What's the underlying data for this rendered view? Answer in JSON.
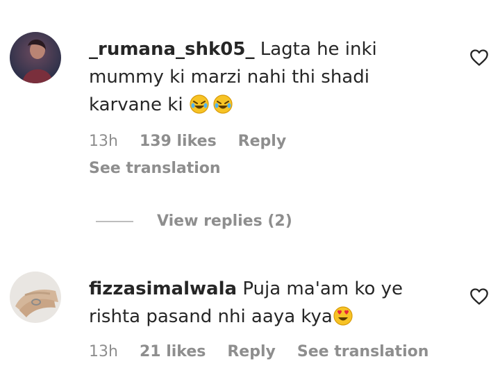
{
  "comments": [
    {
      "username": "_rumana_shk05_",
      "text": "Lagta he inki mummy ki marzi nahi thi shadi karvane ki",
      "emojis": [
        "rolling-on-floor-laughing",
        "rolling-on-floor-laughing"
      ],
      "time": "13h",
      "likes": "139 likes",
      "reply": "Reply",
      "see_translation": "See translation",
      "view_replies": "View replies (2)"
    },
    {
      "username": "fizzasimalwala",
      "text": "Puja ma'am ko ye rishta pasand nhi aaya kya",
      "emojis": [
        "heart-eyes"
      ],
      "time": "13h",
      "likes": "21 likes",
      "reply": "Reply",
      "see_translation": "See translation"
    }
  ],
  "icons": {
    "like": "heart-outline-icon"
  }
}
